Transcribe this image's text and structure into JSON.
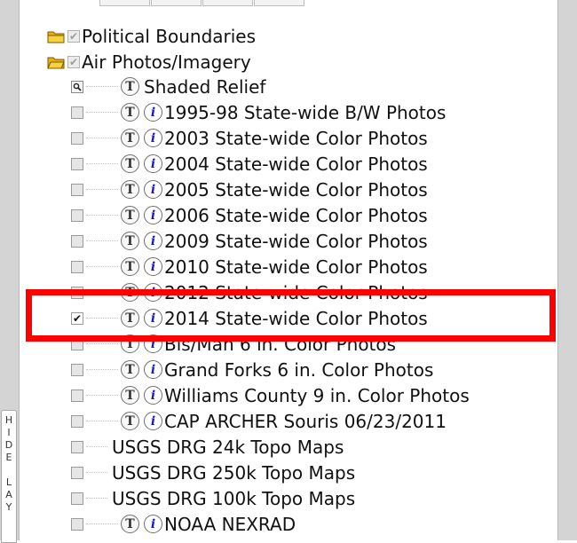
{
  "side_tab": {
    "label": "H\nI\nD\nE\n \nL\nA\nY"
  },
  "tree": {
    "folders": [
      {
        "label": "Political Boundaries",
        "checked": true,
        "icon": "folder-closed-icon"
      },
      {
        "label": "Air Photos/Imagery",
        "checked": true,
        "icon": "folder-open-icon"
      }
    ],
    "layers": [
      {
        "label": "Shaded Relief",
        "checked": false,
        "has_t": true,
        "has_info": false,
        "check_icon": "magnifier-icon"
      },
      {
        "label": "1995-98 State-wide B/W Photos",
        "checked": false,
        "has_t": true,
        "has_info": true
      },
      {
        "label": "2003 State-wide Color Photos",
        "checked": false,
        "has_t": true,
        "has_info": true
      },
      {
        "label": "2004 State-wide Color Photos",
        "checked": false,
        "has_t": true,
        "has_info": true
      },
      {
        "label": "2005 State-wide Color Photos",
        "checked": false,
        "has_t": true,
        "has_info": true
      },
      {
        "label": "2006 State-wide Color Photos",
        "checked": false,
        "has_t": true,
        "has_info": true
      },
      {
        "label": "2009 State-wide Color Photos",
        "checked": false,
        "has_t": true,
        "has_info": true
      },
      {
        "label": "2010 State-wide Color Photos",
        "checked": false,
        "has_t": true,
        "has_info": true
      },
      {
        "label": "2012 State-wide Color Photos",
        "checked": false,
        "has_t": true,
        "has_info": true
      },
      {
        "label": "2014 State-wide Color Photos",
        "checked": true,
        "has_t": true,
        "has_info": true
      },
      {
        "label": "Bis/Man 6 in. Color Photos",
        "checked": false,
        "has_t": true,
        "has_info": true
      },
      {
        "label": "Grand Forks 6 in. Color Photos",
        "checked": false,
        "has_t": true,
        "has_info": true
      },
      {
        "label": "Williams County 9 in. Color Photos",
        "checked": false,
        "has_t": true,
        "has_info": true
      },
      {
        "label": "CAP ARCHER Souris 06/23/2011",
        "checked": false,
        "has_t": true,
        "has_info": true
      },
      {
        "label": "USGS DRG 24k Topo Maps",
        "checked": false,
        "has_t": false,
        "has_info": false
      },
      {
        "label": "USGS DRG 250k Topo Maps",
        "checked": false,
        "has_t": false,
        "has_info": false
      },
      {
        "label": "USGS DRG 100k Topo Maps",
        "checked": false,
        "has_t": false,
        "has_info": false
      },
      {
        "label": "NOAA NEXRAD",
        "checked": false,
        "has_t": true,
        "has_info": true
      }
    ],
    "t_glyph": "T",
    "info_glyph": "i",
    "check_glyph": "✔"
  },
  "colors": {
    "highlight": "#ff0000",
    "info": "#1a1acc",
    "folder": "#f2c21a"
  }
}
